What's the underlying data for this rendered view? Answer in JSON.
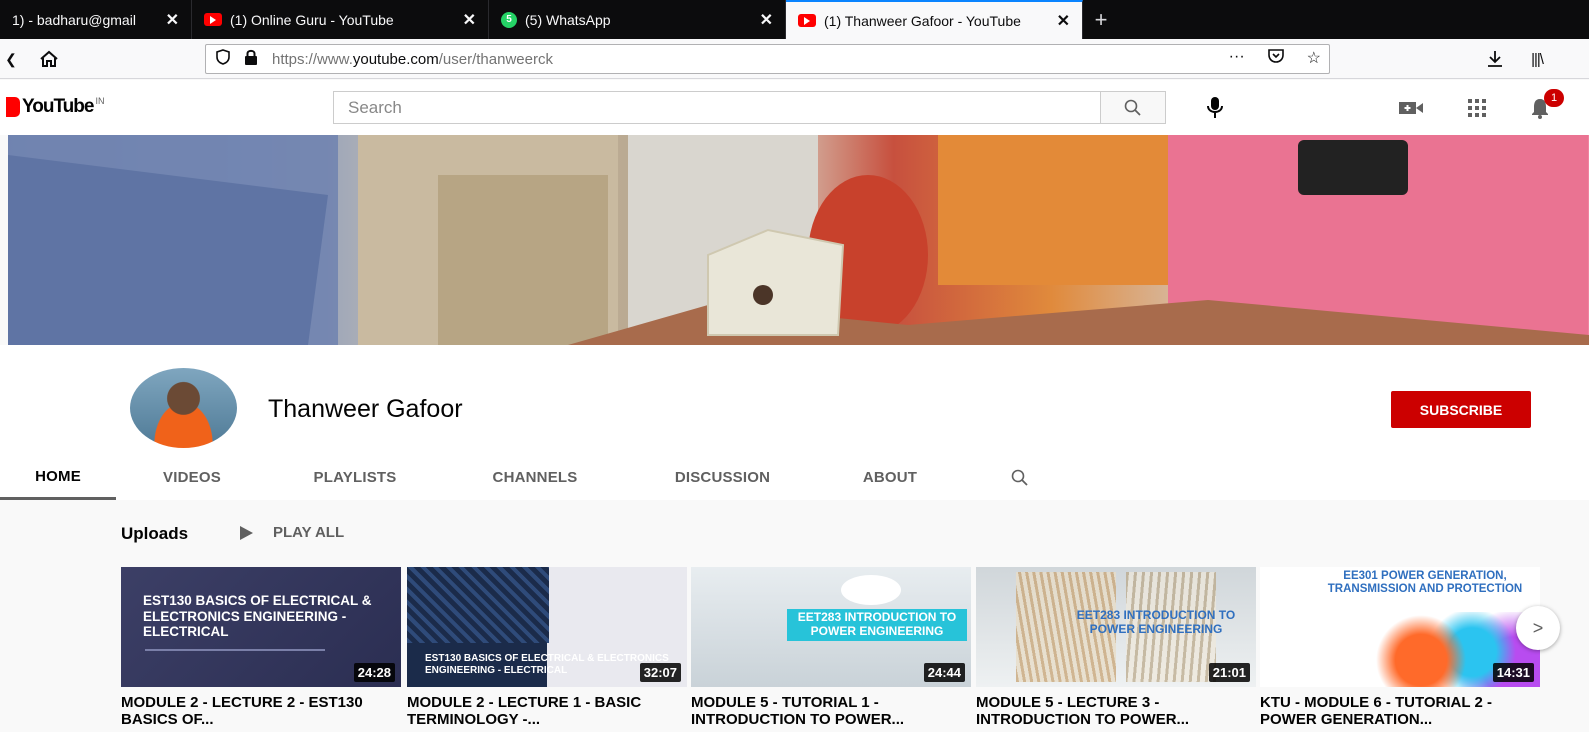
{
  "browser": {
    "tabs": [
      {
        "title": "1) - badharu@gmail",
        "icon": "gmail-icon",
        "active": false
      },
      {
        "title": "(1) Online Guru - YouTube",
        "icon": "youtube-icon",
        "active": false
      },
      {
        "title": "(5) WhatsApp",
        "icon": "whatsapp-icon",
        "badge": "5",
        "active": false
      },
      {
        "title": "(1) Thanweer Gafoor - YouTube",
        "icon": "youtube-icon",
        "active": true
      }
    ],
    "url_prefix": "https://www.",
    "url_domain": "youtube.com",
    "url_path": "/user/thanweerck",
    "page_actions": "···"
  },
  "youtube": {
    "logo_text": "YouTube",
    "country_code": "IN",
    "search_placeholder": "Search",
    "notification_count": "1",
    "brand_color": "#cc0000"
  },
  "channel": {
    "name": "Thanweer Gafoor",
    "subscribe_label": "SUBSCRIBE",
    "tabs": [
      "HOME",
      "VIDEOS",
      "PLAYLISTS",
      "CHANNELS",
      "DISCUSSION",
      "ABOUT"
    ]
  },
  "uploads": {
    "title": "Uploads",
    "play_all": "PLAY ALL",
    "videos": [
      {
        "thumb_title": "EST130 BASICS OF ELECTRICAL & ELECTRONICS ENGINEERING - ELECTRICAL",
        "duration": "24:28",
        "title": "MODULE 2 - LECTURE 2 - EST130 BASICS OF..."
      },
      {
        "thumb_title": "EST130 BASICS OF ELECTRICAL & ELECTRONICS ENGINEERING - ELECTRICAL",
        "duration": "32:07",
        "title": "MODULE 2 - LECTURE 1 - BASIC TERMINOLOGY -..."
      },
      {
        "thumb_title": "EET283 INTRODUCTION TO POWER ENGINEERING",
        "duration": "24:44",
        "title": "MODULE 5 - TUTORIAL 1 - INTRODUCTION TO POWER..."
      },
      {
        "thumb_title": "EET283 INTRODUCTION TO POWER ENGINEERING",
        "duration": "21:01",
        "title": "MODULE 5 - LECTURE 3 - INTRODUCTION TO POWER..."
      },
      {
        "thumb_title": "EE301 POWER GENERATION, TRANSMISSION AND PROTECTION",
        "duration": "14:31",
        "title": "KTU - MODULE 6 - TUTORIAL 2 - POWER GENERATION..."
      }
    ]
  }
}
